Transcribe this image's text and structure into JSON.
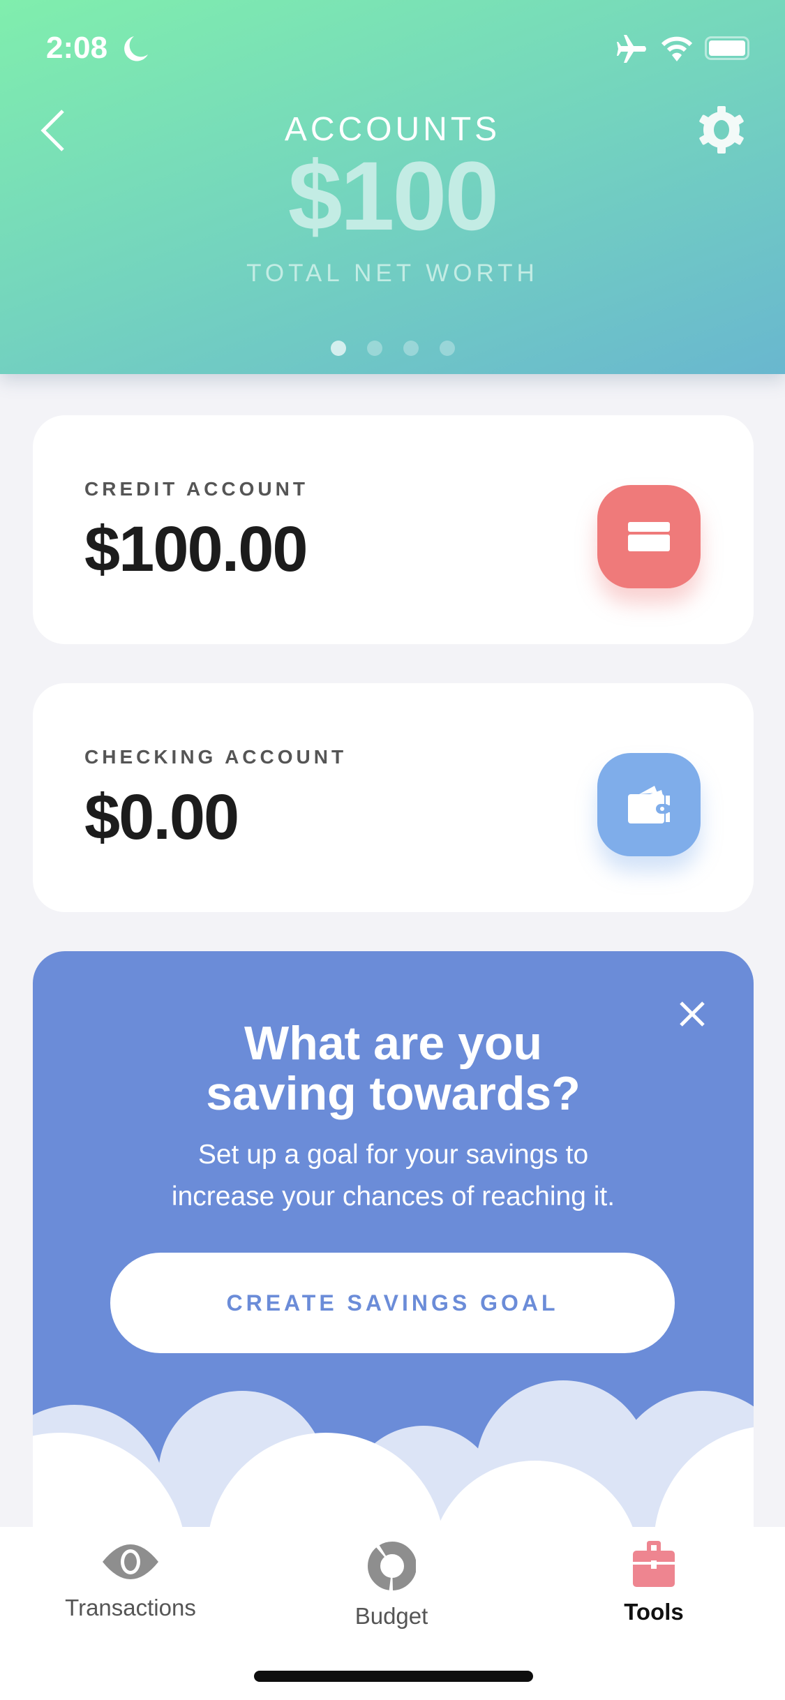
{
  "status_bar": {
    "time": "2:08",
    "icons": [
      "moon-icon",
      "airplane-icon",
      "wifi-icon",
      "battery-icon"
    ]
  },
  "header": {
    "title": "ACCOUNTS",
    "amount": "$100",
    "subtitle": "TOTAL NET WORTH",
    "page_count": 4,
    "active_page": 1
  },
  "accounts": [
    {
      "label": "CREDIT ACCOUNT",
      "amount": "$100.00",
      "icon": "credit-card-icon",
      "color": "#EF7A7A"
    },
    {
      "label": "CHECKING ACCOUNT",
      "amount": "$0.00",
      "icon": "wallet-icon",
      "color": "#7FADEA"
    }
  ],
  "savings": {
    "title_line1": "What are you",
    "title_line2": "saving towards?",
    "text_line1": "Set up a goal for your savings to",
    "text_line2": "increase your chances of reaching it.",
    "button": "CREATE SAVINGS GOAL",
    "color": "#6B8CD8"
  },
  "tabs": [
    {
      "label": "Transactions",
      "icon": "eye-icon"
    },
    {
      "label": "Budget",
      "icon": "pie-chart-icon"
    },
    {
      "label": "Tools",
      "icon": "toolbox-icon",
      "active": true,
      "color": "#EE8590"
    }
  ]
}
